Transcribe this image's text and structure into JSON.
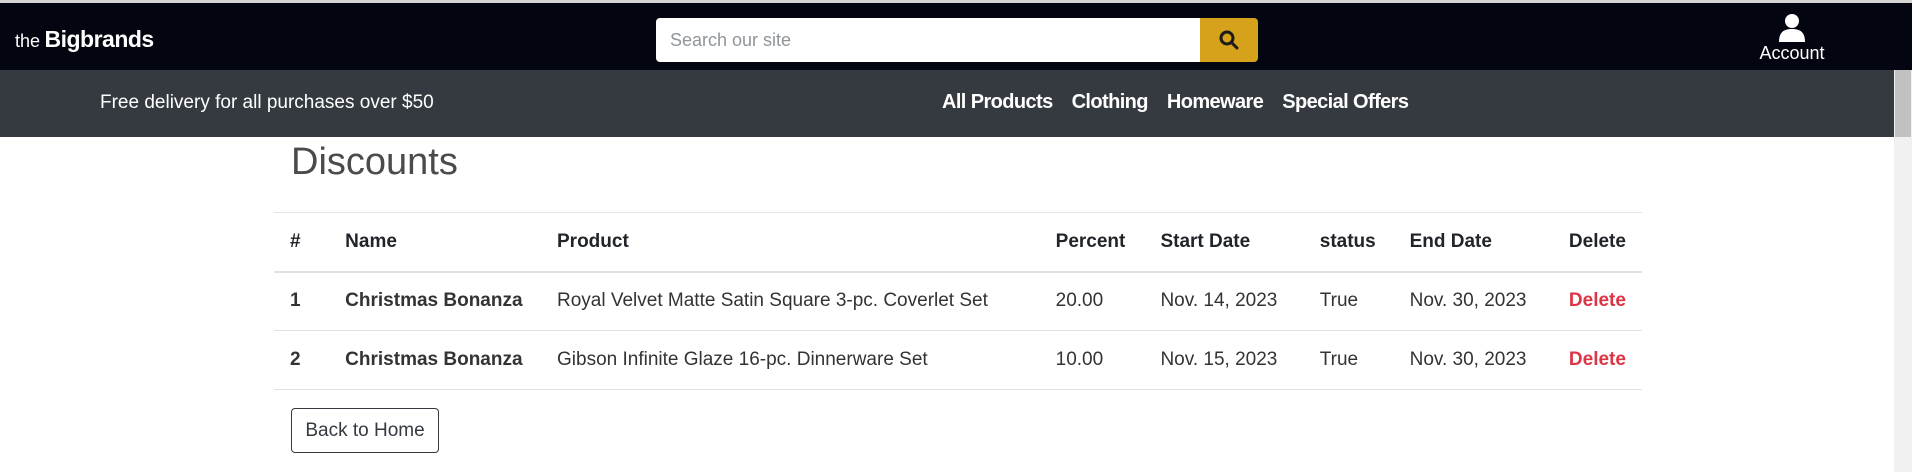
{
  "header": {
    "brand_small": "the",
    "brand_big": "Bigbrands",
    "search_placeholder": "Search our site",
    "search_value": "",
    "search_icon": "search-icon",
    "account_label": "Account",
    "account_icon": "user-icon"
  },
  "navbar": {
    "delivery_text": "Free delivery for all purchases over $50",
    "links": [
      "All Products",
      "Clothing",
      "Homeware",
      "Special Offers"
    ]
  },
  "colors": {
    "topbar": "#030610",
    "navbar": "#343a40",
    "search_button": "#d7a21b",
    "delete_link": "#dc3545"
  },
  "page_title": "Discounts",
  "table": {
    "columns": [
      "#",
      "Name",
      "Product",
      "Percent",
      "Start Date",
      "status",
      "End Date",
      "Delete"
    ],
    "rows": [
      [
        "1",
        "Christmas Bonanza",
        "Royal Velvet Matte Satin Square 3-pc. Coverlet Set",
        "20.00",
        "Nov. 14, 2023",
        "True",
        "Nov. 30, 2023",
        "Delete"
      ],
      [
        "2",
        "Christmas Bonanza",
        "Gibson Infinite Glaze 16-pc. Dinnerware Set",
        "10.00",
        "Nov. 15, 2023",
        "True",
        "Nov. 30, 2023",
        "Delete"
      ]
    ]
  },
  "back_button_label": "Back to Home"
}
